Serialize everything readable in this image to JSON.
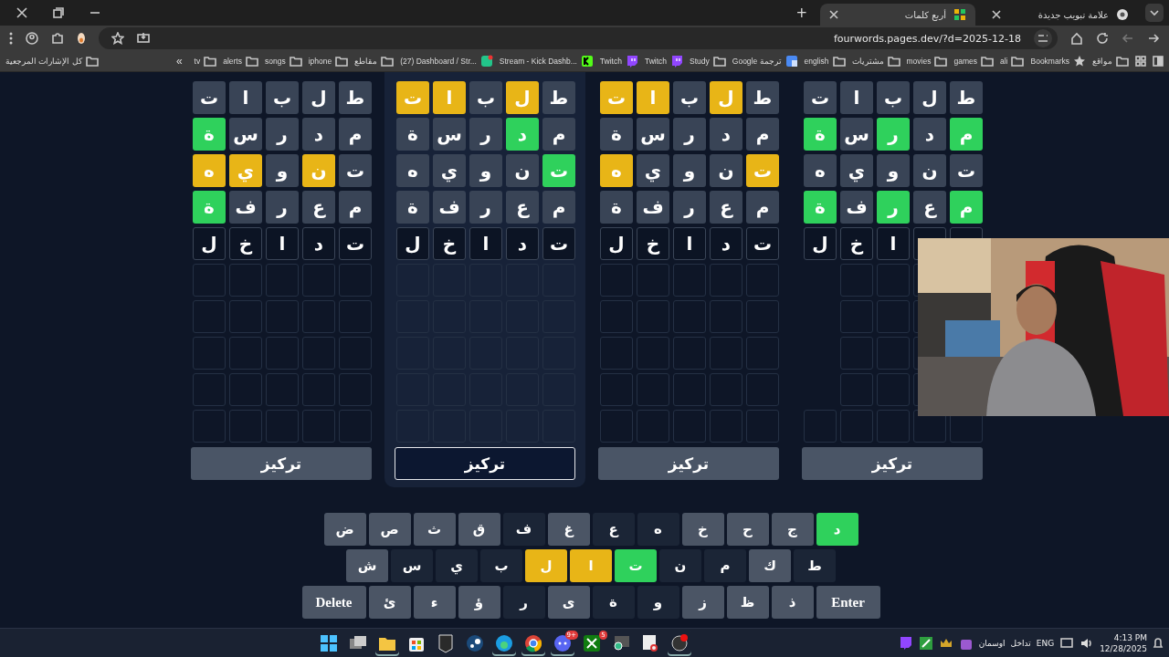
{
  "browser": {
    "tabs": [
      {
        "title": "علامة تبويب جديدة",
        "kind": "newtab",
        "selected": false
      },
      {
        "title": "أربع كلمات",
        "kind": "game",
        "selected": true
      }
    ],
    "new_tab": "+",
    "address": "fourwords.pages.dev/?d=2025-12-18",
    "bookmarks": [
      {
        "label": "مواقع",
        "kind": "folder"
      },
      {
        "label": "Bookmarks",
        "kind": "star"
      },
      {
        "label": "ali",
        "kind": "folder"
      },
      {
        "label": "games",
        "kind": "folder"
      },
      {
        "label": "movies",
        "kind": "folder"
      },
      {
        "label": "مشتريات",
        "kind": "folder"
      },
      {
        "label": "english",
        "kind": "folder"
      },
      {
        "label": "Google ترجمة",
        "kind": "translate"
      },
      {
        "label": "Study",
        "kind": "folder"
      },
      {
        "label": "Twitch",
        "kind": "twitch"
      },
      {
        "label": "Twitch",
        "kind": "twitch"
      },
      {
        "label": "Stream - Kick Dashb...",
        "kind": "kick"
      },
      {
        "label": "(27) Dashboard / Str...",
        "kind": "stream"
      },
      {
        "label": "مقاطع",
        "kind": "folder"
      },
      {
        "label": "iphone",
        "kind": "folder"
      },
      {
        "label": "songs",
        "kind": "folder"
      },
      {
        "label": "alerts",
        "kind": "folder"
      },
      {
        "label": "tv",
        "kind": "folder"
      }
    ],
    "overflow": "«",
    "all_bookmarks": "كل الإشارات المرجعية"
  },
  "boards": [
    {
      "selected": false,
      "focus_label": "تركيز",
      "rows": [
        {
          "kind": "guess",
          "tiles": [
            {
              "letter": "ط",
              "color": "#394456"
            },
            {
              "letter": "ل",
              "color": "#394456"
            },
            {
              "letter": "ب",
              "color": "#394456"
            },
            {
              "letter": "ا",
              "color": "#394456"
            },
            {
              "letter": "ت",
              "color": "#394456"
            }
          ]
        },
        {
          "kind": "guess",
          "tiles": [
            {
              "letter": "م",
              "color": "#2fd15c"
            },
            {
              "letter": "د",
              "color": "#394456"
            },
            {
              "letter": "ر",
              "color": "#2fd15c"
            },
            {
              "letter": "س",
              "color": "#394456"
            },
            {
              "letter": "ة",
              "color": "#2fd15c"
            }
          ]
        },
        {
          "kind": "guess",
          "tiles": [
            {
              "letter": "ت",
              "color": "#394456"
            },
            {
              "letter": "ن",
              "color": "#394456"
            },
            {
              "letter": "و",
              "color": "#394456"
            },
            {
              "letter": "ي",
              "color": "#394456"
            },
            {
              "letter": "ه",
              "color": "#394456"
            }
          ]
        },
        {
          "kind": "guess",
          "tiles": [
            {
              "letter": "م",
              "color": "#2fd15c"
            },
            {
              "letter": "ع",
              "color": "#394456"
            },
            {
              "letter": "ر",
              "color": "#2fd15c"
            },
            {
              "letter": "ف",
              "color": "#394456"
            },
            {
              "letter": "ة",
              "color": "#2fd15c"
            }
          ]
        },
        {
          "kind": "input",
          "tiles": [
            {
              "letter": "ا"
            },
            {
              "letter": "خ"
            },
            {
              "letter": "ل"
            }
          ]
        },
        {
          "kind": "empty_covered"
        },
        {
          "kind": "empty_covered"
        },
        {
          "kind": "empty_covered"
        },
        {
          "kind": "empty_covered"
        },
        {
          "kind": "empty"
        }
      ]
    },
    {
      "selected": false,
      "focus_label": "تركيز",
      "rows": [
        {
          "kind": "guess",
          "tiles": [
            {
              "letter": "ط",
              "color": "#394456"
            },
            {
              "letter": "ل",
              "color": "#e8b517"
            },
            {
              "letter": "ب",
              "color": "#394456"
            },
            {
              "letter": "ا",
              "color": "#e8b517"
            },
            {
              "letter": "ت",
              "color": "#e8b517"
            }
          ]
        },
        {
          "kind": "guess",
          "tiles": [
            {
              "letter": "م",
              "color": "#394456"
            },
            {
              "letter": "د",
              "color": "#394456"
            },
            {
              "letter": "ر",
              "color": "#394456"
            },
            {
              "letter": "س",
              "color": "#394456"
            },
            {
              "letter": "ة",
              "color": "#394456"
            }
          ]
        },
        {
          "kind": "guess",
          "tiles": [
            {
              "letter": "ت",
              "color": "#e8b517"
            },
            {
              "letter": "ن",
              "color": "#394456"
            },
            {
              "letter": "و",
              "color": "#394456"
            },
            {
              "letter": "ي",
              "color": "#394456"
            },
            {
              "letter": "ه",
              "color": "#e8b517"
            }
          ]
        },
        {
          "kind": "guess",
          "tiles": [
            {
              "letter": "م",
              "color": "#394456"
            },
            {
              "letter": "ع",
              "color": "#394456"
            },
            {
              "letter": "ر",
              "color": "#394456"
            },
            {
              "letter": "ف",
              "color": "#394456"
            },
            {
              "letter": "ة",
              "color": "#394456"
            }
          ]
        },
        {
          "kind": "input",
          "tiles": [
            {
              "letter": "ت"
            },
            {
              "letter": "د"
            },
            {
              "letter": "ا"
            },
            {
              "letter": "خ"
            },
            {
              "letter": "ل"
            }
          ]
        },
        {
          "kind": "empty"
        },
        {
          "kind": "empty"
        },
        {
          "kind": "empty"
        },
        {
          "kind": "empty"
        },
        {
          "kind": "empty"
        }
      ]
    },
    {
      "selected": true,
      "focus_label": "تركيز",
      "rows": [
        {
          "kind": "guess",
          "tiles": [
            {
              "letter": "ط",
              "color": "#394456"
            },
            {
              "letter": "ل",
              "color": "#e8b517"
            },
            {
              "letter": "ب",
              "color": "#394456"
            },
            {
              "letter": "ا",
              "color": "#e8b517"
            },
            {
              "letter": "ت",
              "color": "#e8b517"
            }
          ]
        },
        {
          "kind": "guess",
          "tiles": [
            {
              "letter": "م",
              "color": "#394456"
            },
            {
              "letter": "د",
              "color": "#2fd15c"
            },
            {
              "letter": "ر",
              "color": "#394456"
            },
            {
              "letter": "س",
              "color": "#394456"
            },
            {
              "letter": "ة",
              "color": "#394456"
            }
          ]
        },
        {
          "kind": "guess",
          "tiles": [
            {
              "letter": "ت",
              "color": "#2fd15c"
            },
            {
              "letter": "ن",
              "color": "#394456"
            },
            {
              "letter": "و",
              "color": "#394456"
            },
            {
              "letter": "ي",
              "color": "#394456"
            },
            {
              "letter": "ه",
              "color": "#394456"
            }
          ]
        },
        {
          "kind": "guess",
          "tiles": [
            {
              "letter": "م",
              "color": "#394456"
            },
            {
              "letter": "ع",
              "color": "#394456"
            },
            {
              "letter": "ر",
              "color": "#394456"
            },
            {
              "letter": "ف",
              "color": "#394456"
            },
            {
              "letter": "ة",
              "color": "#394456"
            }
          ]
        },
        {
          "kind": "input",
          "tiles": [
            {
              "letter": "ت"
            },
            {
              "letter": "د"
            },
            {
              "letter": "ا"
            },
            {
              "letter": "خ"
            },
            {
              "letter": "ل"
            }
          ]
        },
        {
          "kind": "empty"
        },
        {
          "kind": "empty"
        },
        {
          "kind": "empty"
        },
        {
          "kind": "empty"
        },
        {
          "kind": "empty"
        }
      ]
    },
    {
      "selected": false,
      "focus_label": "تركيز",
      "rows": [
        {
          "kind": "guess",
          "tiles": [
            {
              "letter": "ط",
              "color": "#394456"
            },
            {
              "letter": "ل",
              "color": "#394456"
            },
            {
              "letter": "ب",
              "color": "#394456"
            },
            {
              "letter": "ا",
              "color": "#394456"
            },
            {
              "letter": "ت",
              "color": "#394456"
            }
          ]
        },
        {
          "kind": "guess",
          "tiles": [
            {
              "letter": "م",
              "color": "#394456"
            },
            {
              "letter": "د",
              "color": "#394456"
            },
            {
              "letter": "ر",
              "color": "#394456"
            },
            {
              "letter": "س",
              "color": "#394456"
            },
            {
              "letter": "ة",
              "color": "#2fd15c"
            }
          ]
        },
        {
          "kind": "guess",
          "tiles": [
            {
              "letter": "ت",
              "color": "#394456"
            },
            {
              "letter": "ن",
              "color": "#e8b517"
            },
            {
              "letter": "و",
              "color": "#394456"
            },
            {
              "letter": "ي",
              "color": "#e8b517"
            },
            {
              "letter": "ه",
              "color": "#e8b517"
            }
          ]
        },
        {
          "kind": "guess",
          "tiles": [
            {
              "letter": "م",
              "color": "#394456"
            },
            {
              "letter": "ع",
              "color": "#394456"
            },
            {
              "letter": "ر",
              "color": "#394456"
            },
            {
              "letter": "ف",
              "color": "#394456"
            },
            {
              "letter": "ة",
              "color": "#2fd15c"
            }
          ]
        },
        {
          "kind": "input",
          "tiles": [
            {
              "letter": "ت"
            },
            {
              "letter": "د"
            },
            {
              "letter": "ا"
            },
            {
              "letter": "خ"
            },
            {
              "letter": "ل"
            }
          ]
        },
        {
          "kind": "empty"
        },
        {
          "kind": "empty"
        },
        {
          "kind": "empty"
        },
        {
          "kind": "empty"
        },
        {
          "kind": "empty"
        }
      ]
    }
  ],
  "keyboard": [
    [
      {
        "label": "د",
        "color": "#2fd15c"
      },
      {
        "label": "ج",
        "color": "#4b5565"
      },
      {
        "label": "ح",
        "color": "#4b5565"
      },
      {
        "label": "خ",
        "color": "#4b5565"
      },
      {
        "label": "ه",
        "color": "#1b2536"
      },
      {
        "label": "ع",
        "color": "#1b2536"
      },
      {
        "label": "غ",
        "color": "#4b5565"
      },
      {
        "label": "ف",
        "color": "#1b2536"
      },
      {
        "label": "ق",
        "color": "#4b5565"
      },
      {
        "label": "ث",
        "color": "#4b5565"
      },
      {
        "label": "ص",
        "color": "#4b5565"
      },
      {
        "label": "ض",
        "color": "#4b5565"
      }
    ],
    [
      {
        "label": "ط",
        "color": "#1b2536"
      },
      {
        "label": "ك",
        "color": "#4b5565"
      },
      {
        "label": "م",
        "color": "#1b2536"
      },
      {
        "label": "ن",
        "color": "#1b2536"
      },
      {
        "label": "ت",
        "color": "#2fd15c"
      },
      {
        "label": "ا",
        "color": "#e8b517"
      },
      {
        "label": "ل",
        "color": "#e8b517"
      },
      {
        "label": "ب",
        "color": "#1b2536"
      },
      {
        "label": "ي",
        "color": "#1b2536"
      },
      {
        "label": "س",
        "color": "#1b2536"
      },
      {
        "label": "ش",
        "color": "#4b5565"
      }
    ],
    [
      {
        "label": "Enter",
        "color": "#4b5565",
        "kind": "action"
      },
      {
        "label": "ذ",
        "color": "#4b5565"
      },
      {
        "label": "ظ",
        "color": "#4b5565"
      },
      {
        "label": "ز",
        "color": "#4b5565"
      },
      {
        "label": "و",
        "color": "#1b2536"
      },
      {
        "label": "ة",
        "color": "#1b2536"
      },
      {
        "label": "ى",
        "color": "#4b5565"
      },
      {
        "label": "ر",
        "color": "#1b2536"
      },
      {
        "label": "ؤ",
        "color": "#4b5565"
      },
      {
        "label": "ء",
        "color": "#4b5565"
      },
      {
        "label": "ئ",
        "color": "#4b5565"
      },
      {
        "label": "Delete",
        "color": "#4b5565",
        "kind": "action"
      }
    ]
  ],
  "webcam": {
    "kind": "picture"
  },
  "taskbar": {
    "apps": [
      {
        "kind": "obs",
        "selected": true
      },
      {
        "kind": "snip",
        "selected": false
      },
      {
        "kind": "zoom",
        "selected": false
      },
      {
        "kind": "xbox",
        "selected": false,
        "badge": "5"
      },
      {
        "kind": "discord",
        "selected": true,
        "badge": "9+"
      },
      {
        "kind": "chrome",
        "selected": true
      },
      {
        "kind": "edge",
        "selected": true
      },
      {
        "kind": "steam",
        "selected": false
      },
      {
        "kind": "epic",
        "selected": false
      },
      {
        "kind": "store",
        "selected": false
      },
      {
        "kind": "files",
        "selected": true
      },
      {
        "kind": "taskview",
        "selected": false
      },
      {
        "kind": "start",
        "selected": false
      }
    ],
    "tray_labels": [
      "تداخل",
      "اوسمان"
    ],
    "language": "ENG",
    "time": "4:13 PM",
    "date": "12/28/2025"
  }
}
